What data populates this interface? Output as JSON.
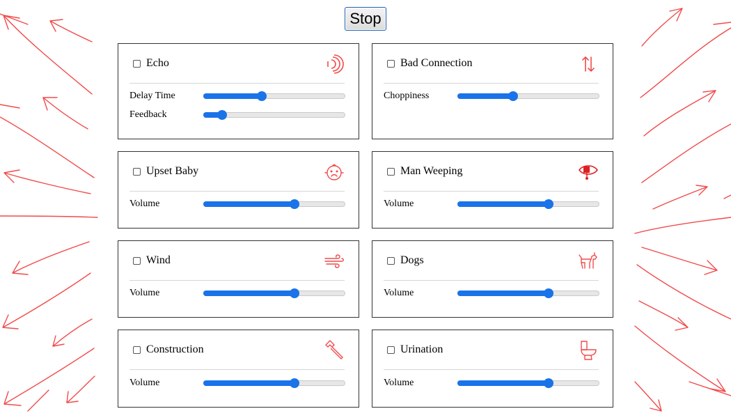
{
  "stop_label": "Stop",
  "accent_color": "#1a73e8",
  "decoration_color": "#f24a4a",
  "panels": [
    {
      "title": "Echo",
      "icon": "echo-waves-icon",
      "controls": [
        {
          "label": "Delay Time",
          "value": 0.41
        },
        {
          "label": "Feedback",
          "value": 0.13
        }
      ]
    },
    {
      "title": "Bad Connection",
      "icon": "up-down-arrows-icon",
      "controls": [
        {
          "label": "Choppiness",
          "value": 0.39
        }
      ]
    },
    {
      "title": "Upset Baby",
      "icon": "baby-face-icon",
      "controls": [
        {
          "label": "Volume",
          "value": 0.64
        }
      ]
    },
    {
      "title": "Man Weeping",
      "icon": "weeping-eye-icon",
      "controls": [
        {
          "label": "Volume",
          "value": 0.64
        }
      ]
    },
    {
      "title": "Wind",
      "icon": "wind-icon",
      "controls": [
        {
          "label": "Volume",
          "value": 0.64
        }
      ]
    },
    {
      "title": "Dogs",
      "icon": "dog-icon",
      "controls": [
        {
          "label": "Volume",
          "value": 0.64
        }
      ]
    },
    {
      "title": "Construction",
      "icon": "hammer-icon",
      "controls": [
        {
          "label": "Volume",
          "value": 0.64
        }
      ]
    },
    {
      "title": "Urination",
      "icon": "toilet-icon",
      "controls": [
        {
          "label": "Volume",
          "value": 0.64
        }
      ]
    }
  ]
}
